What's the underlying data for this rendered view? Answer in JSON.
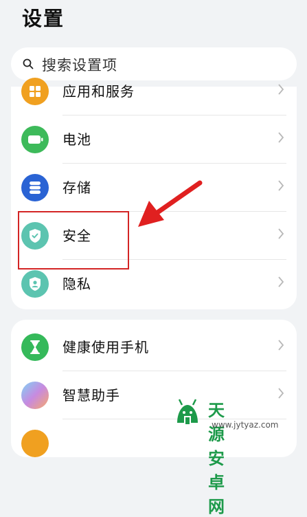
{
  "header": {
    "title": "设置"
  },
  "search": {
    "placeholder": "搜索设置项"
  },
  "group1": {
    "items": [
      {
        "label": "应用和服务",
        "icon": "apps-icon",
        "color": "#f0a020"
      },
      {
        "label": "电池",
        "icon": "battery-icon",
        "color": "#3dba5a"
      },
      {
        "label": "存储",
        "icon": "storage-icon",
        "color": "#2a63d4"
      },
      {
        "label": "安全",
        "icon": "shield-check-icon",
        "color": "#5cc4b0"
      },
      {
        "label": "隐私",
        "icon": "privacy-shield-icon",
        "color": "#5cc4b0"
      }
    ]
  },
  "group2": {
    "items": [
      {
        "label": "健康使用手机",
        "icon": "hourglass-icon",
        "color": "#35b95a"
      },
      {
        "label": "智慧助手",
        "icon": "assistant-icon",
        "color": "#c78ae0"
      }
    ]
  },
  "watermark": {
    "text": "天源安卓网",
    "url": "www.jytyaz.com"
  },
  "annotation": {
    "color": "#d32424"
  }
}
